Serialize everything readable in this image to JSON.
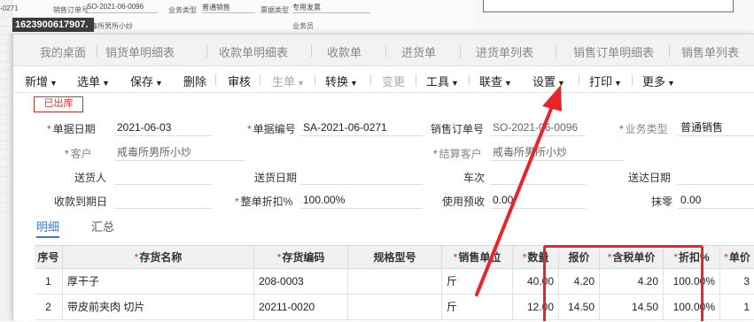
{
  "background": {
    "code_snippet": "-0271",
    "sales_order_label": "销售订单号",
    "sales_order_value": "SO-2021-06-0096",
    "biz_type_label": "业务类型",
    "biz_type_value": "普通销售",
    "invoice_type_label": "票据类型",
    "invoice_type_value": "专用发票",
    "customer_snippet": "毒所男所小炒",
    "salesperson_label": "业务员",
    "tooltip": "1623900617907."
  },
  "tabs": [
    "我的桌面",
    "销货单明细表",
    "收款单明细表",
    "收款单",
    "进货单",
    "进货单列表",
    "销售订单明细表",
    "销售单列表"
  ],
  "toolbar": {
    "new": "新增",
    "select": "选单",
    "save": "保存",
    "delete": "删除",
    "audit": "审核",
    "generate": "生单",
    "convert": "转换",
    "change": "变更",
    "tools": "工具",
    "linked_query": "联查",
    "settings": "设置",
    "print": "打印",
    "more": "更多"
  },
  "status_badge": "已出库",
  "form": {
    "doc_date": {
      "label": "单据日期",
      "value": "2021-06-03"
    },
    "doc_no": {
      "label": "单据编号",
      "value": "SA-2021-06-0271"
    },
    "sales_order_no": {
      "label": "销售订单号",
      "value": "SO-2021-06-0096"
    },
    "biz_type": {
      "label": "业务类型",
      "value": "普通销售"
    },
    "customer": {
      "label": "客户",
      "value": "戒毒所男所小炒"
    },
    "settle_customer": {
      "label": "结算客户",
      "value": "戒毒所男所小炒"
    },
    "sender": {
      "label": "送货人",
      "value": ""
    },
    "delivery_date": {
      "label": "送货日期",
      "value": ""
    },
    "vehicle_no": {
      "label": "车次",
      "value": ""
    },
    "arrival_date": {
      "label": "送达日期",
      "value": ""
    },
    "payment_due": {
      "label": "收款到期日",
      "value": ""
    },
    "discount": {
      "label": "整单折扣%",
      "value": "100.00%"
    },
    "prepay": {
      "label": "使用预收",
      "value": "0.00"
    },
    "rounding": {
      "label": "抹零",
      "value": "0.00"
    }
  },
  "subtabs": {
    "detail": "明细",
    "summary": "汇总"
  },
  "table": {
    "headers": [
      "序号",
      "存货名称",
      "存货编码",
      "规格型号",
      "销售单位",
      "数量",
      "报价",
      "含税单价",
      "折扣%",
      "单价"
    ],
    "rows": [
      {
        "idx": "1",
        "name": "厚干子",
        "code": "208-0003",
        "spec": "",
        "unit": "斤",
        "qty": "40.00",
        "quote": "4.20",
        "tax_price": "4.20",
        "discount": "100.00%",
        "price": "3"
      },
      {
        "idx": "2",
        "name": "带皮前夹肉 切片",
        "code": "20211-0020",
        "spec": "",
        "unit": "斤",
        "qty": "12.00",
        "quote": "14.50",
        "tax_price": "14.50",
        "discount": "100.00%",
        "price": "1"
      }
    ]
  },
  "colors": {
    "accent": "#3a7bd5",
    "required": "#e0302a",
    "annotation": "#e8262a"
  }
}
